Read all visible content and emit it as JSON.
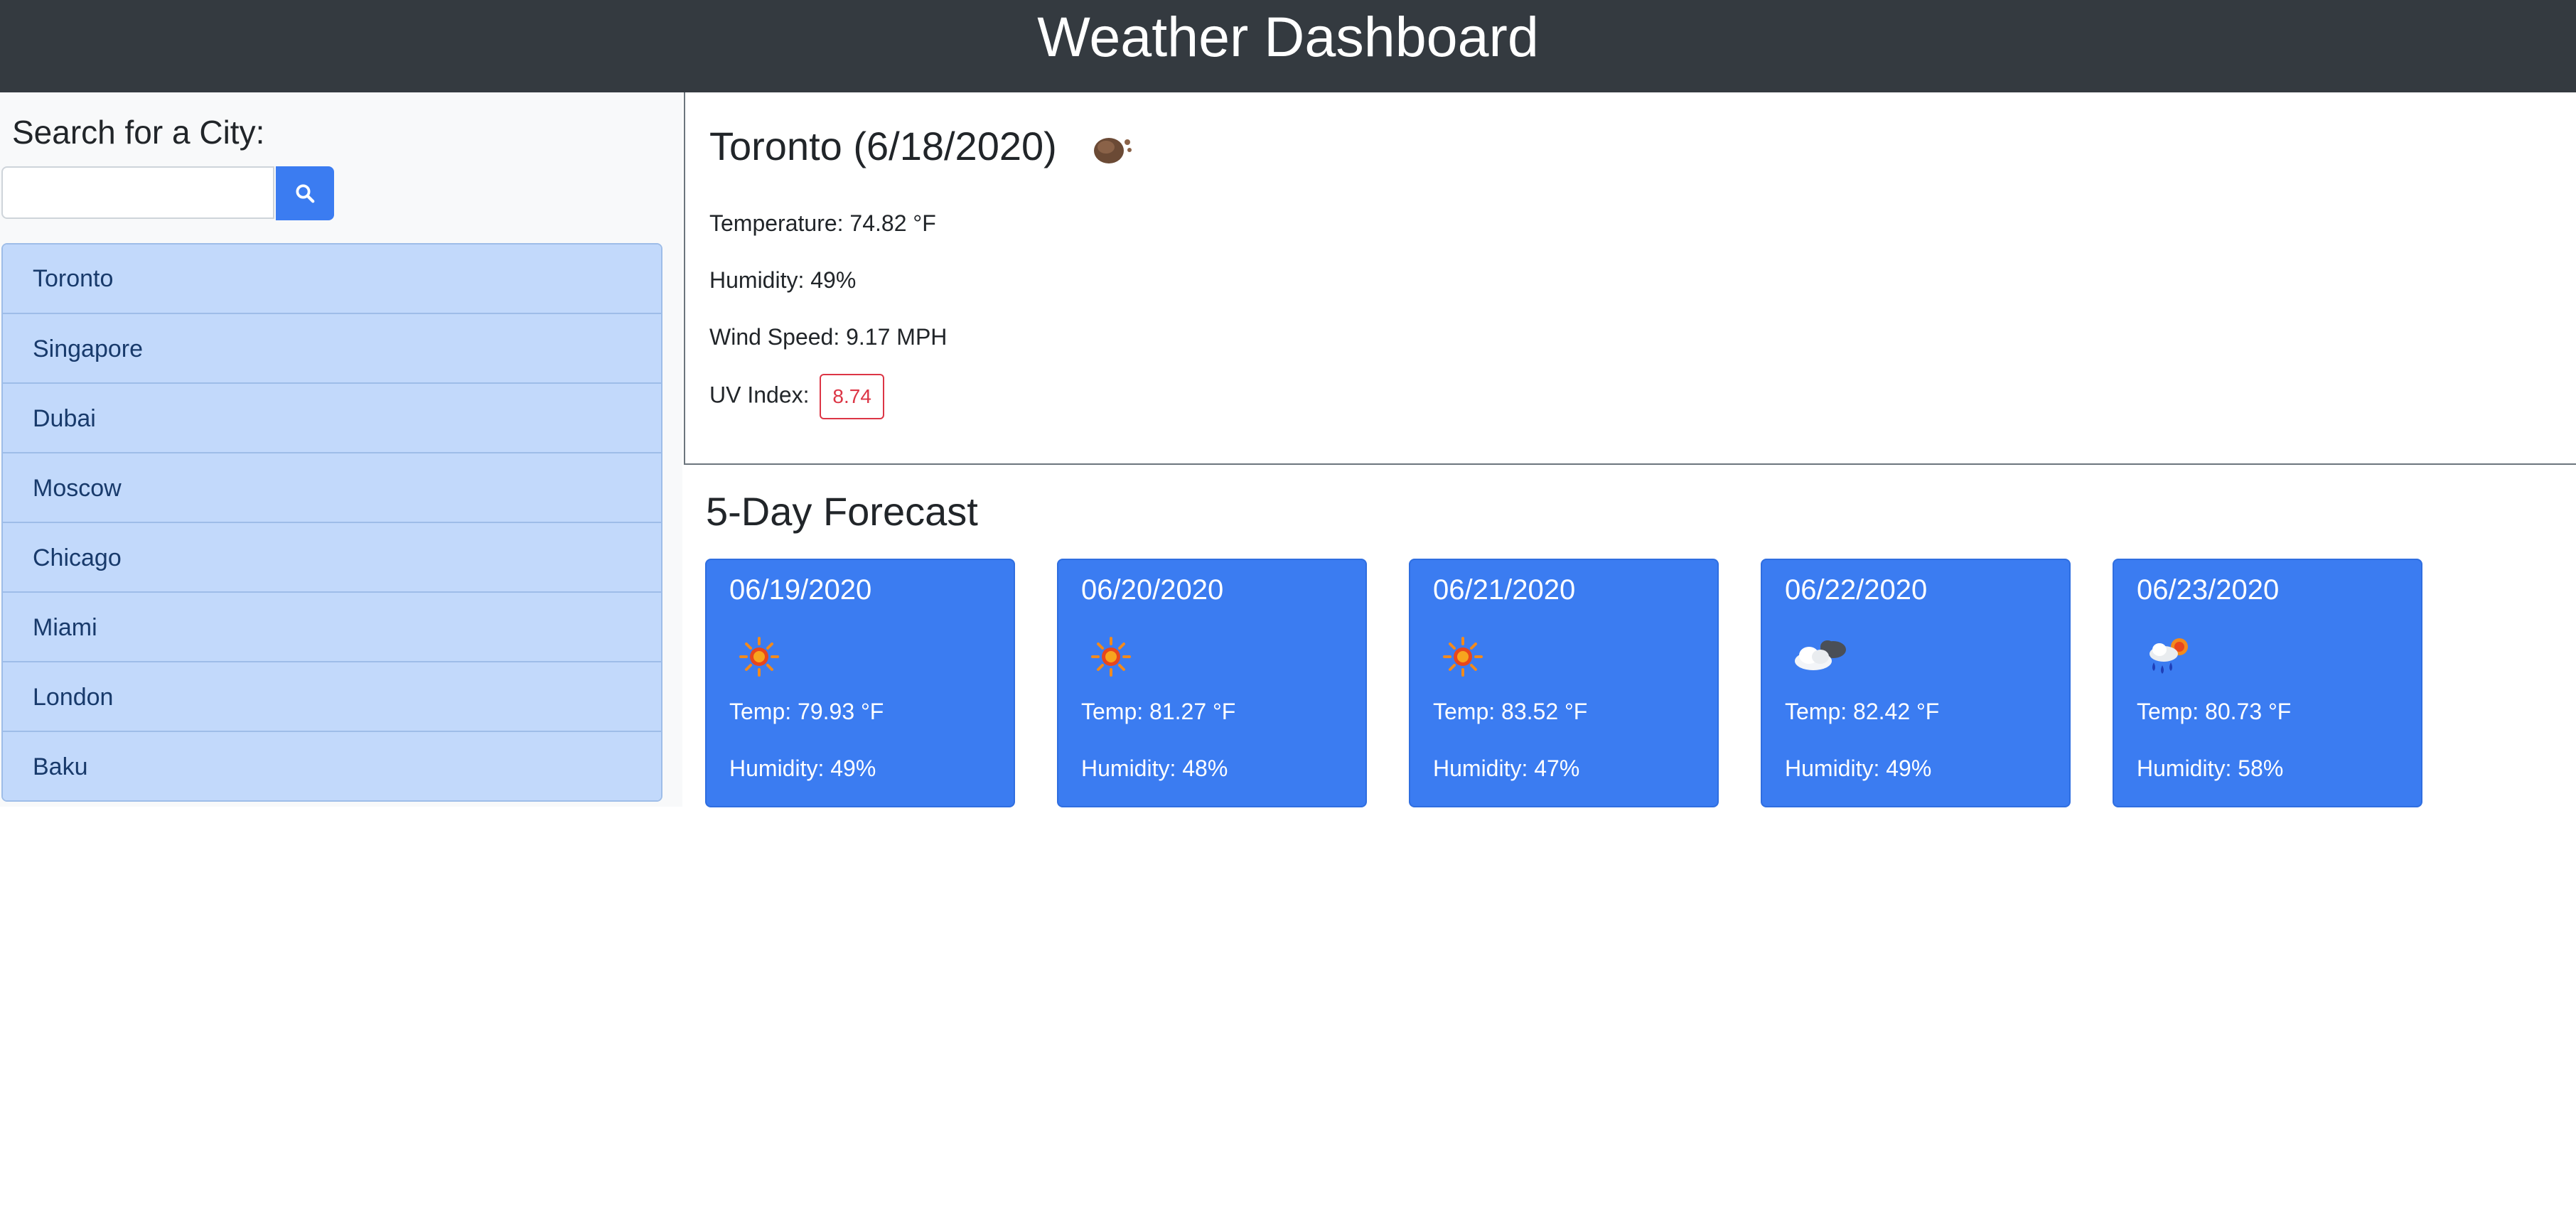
{
  "header": {
    "title": "Weather Dashboard"
  },
  "sidebar": {
    "heading": "Search for a City:",
    "search_value": "",
    "cities": [
      "Toronto",
      "Singapore",
      "Dubai",
      "Moscow",
      "Chicago",
      "Miami",
      "London",
      "Baku"
    ]
  },
  "current": {
    "title": "Toronto (6/18/2020)",
    "icon": "moon-clouds-icon",
    "temperature": "Temperature: 74.82 °F",
    "humidity": "Humidity: 49%",
    "wind": "Wind Speed: 9.17 MPH",
    "uv_label": "UV Index:",
    "uv_value": "8.74",
    "uv_color": "#dc3545"
  },
  "forecast": {
    "title": "5-Day Forecast",
    "cards": [
      {
        "date": "06/19/2020",
        "icon": "sun-icon",
        "temp": "Temp: 79.93 °F",
        "humidity": "Humidity: 49%"
      },
      {
        "date": "06/20/2020",
        "icon": "sun-icon",
        "temp": "Temp: 81.27 °F",
        "humidity": "Humidity: 48%"
      },
      {
        "date": "06/21/2020",
        "icon": "sun-icon",
        "temp": "Temp: 83.52 °F",
        "humidity": "Humidity: 47%"
      },
      {
        "date": "06/22/2020",
        "icon": "clouds-icon",
        "temp": "Temp: 82.42 °F",
        "humidity": "Humidity: 49%"
      },
      {
        "date": "06/23/2020",
        "icon": "rain-sun-icon",
        "temp": "Temp: 80.73 °F",
        "humidity": "Humidity: 58%"
      }
    ]
  },
  "colors": {
    "navbar": "#343a40",
    "accent": "#3b7cf1",
    "city_bg": "#c2d9fb"
  }
}
